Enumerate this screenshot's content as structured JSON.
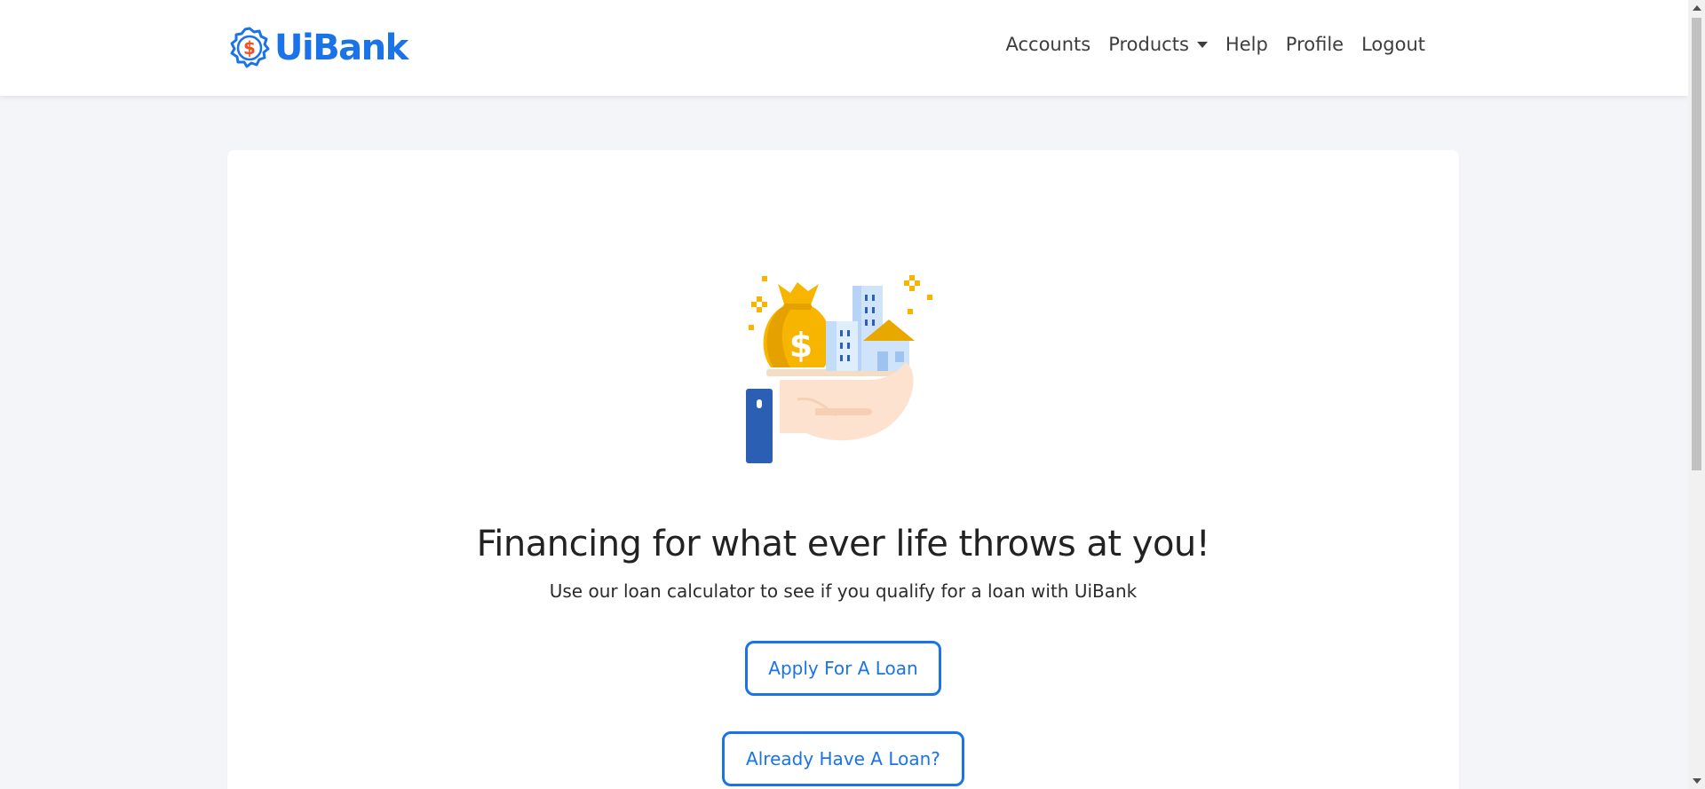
{
  "brand": {
    "name": "UiBank",
    "icon": "dollar-badge-icon",
    "accent_color": "#1a73e8",
    "icon_color": "#f4511e"
  },
  "nav": {
    "items": [
      {
        "label": "Accounts"
      },
      {
        "label": "Products",
        "has_dropdown": true
      },
      {
        "label": "Help"
      },
      {
        "label": "Profile"
      },
      {
        "label": "Logout"
      }
    ]
  },
  "hero": {
    "illustration": "loan-hand-money-bag-buildings-icon",
    "title": "Financing for what ever life throws at you!",
    "subtitle": "Use our loan calculator to see if you qualify for a loan with UiBank"
  },
  "actions": {
    "apply_label": "Apply For A Loan",
    "existing_label": "Already Have A Loan?"
  }
}
